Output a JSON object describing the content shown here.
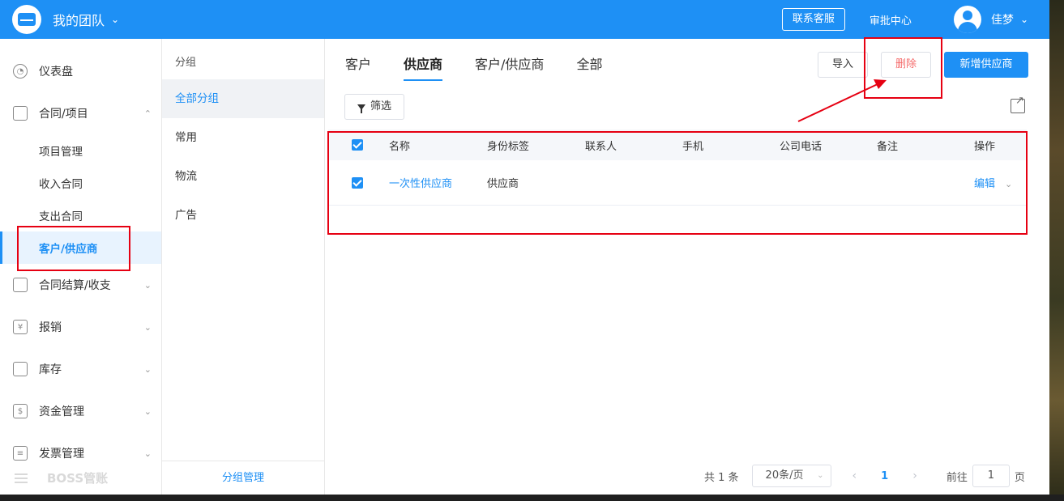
{
  "header": {
    "team_title": "我的团队",
    "contact_label": "联系客服",
    "approval_label": "审批中心",
    "user_name": "佳梦"
  },
  "sidebar": {
    "items": [
      {
        "label": "仪表盘",
        "icon": "dashboard-icon"
      },
      {
        "label": "合同/项目",
        "icon": "folder-icon",
        "expanded": true
      },
      {
        "label": "合同结算/收支",
        "icon": "settlement-icon"
      },
      {
        "label": "报销",
        "icon": "yen-icon"
      },
      {
        "label": "库存",
        "icon": "box-icon"
      },
      {
        "label": "资金管理",
        "icon": "money-icon"
      },
      {
        "label": "发票管理",
        "icon": "invoice-icon"
      }
    ],
    "sub_items": [
      "项目管理",
      "收入合同",
      "支出合同",
      "客户/供应商"
    ],
    "active_sub": "客户/供应商",
    "brand": "BOSS管账"
  },
  "groups": {
    "title": "分组",
    "items": [
      "全部分组",
      "常用",
      "物流",
      "广告"
    ],
    "active": "全部分组",
    "manage_label": "分组管理"
  },
  "main": {
    "tabs": [
      "客户",
      "供应商",
      "客户/供应商",
      "全部"
    ],
    "active_tab": "供应商",
    "import_label": "导入",
    "delete_label": "删除",
    "new_label": "新增供应商",
    "filter_label": "筛选",
    "table": {
      "headers": [
        "名称",
        "身份标签",
        "联系人",
        "手机",
        "公司电话",
        "备注",
        "操作"
      ],
      "rows": [
        {
          "name": "一次性供应商",
          "tag": "供应商",
          "contact": "",
          "mobile": "",
          "phone": "",
          "note": "",
          "op": "编辑",
          "checked": true
        }
      ]
    },
    "pagination": {
      "total": "共 1 条",
      "page_size": "20条/页",
      "current_page": "1",
      "goto_label": "前往",
      "goto_value": "1",
      "page_suffix": "页"
    }
  },
  "colors": {
    "accent": "#1e90f5",
    "annotation": "#e60012",
    "delete_text": "#f56c6c"
  }
}
